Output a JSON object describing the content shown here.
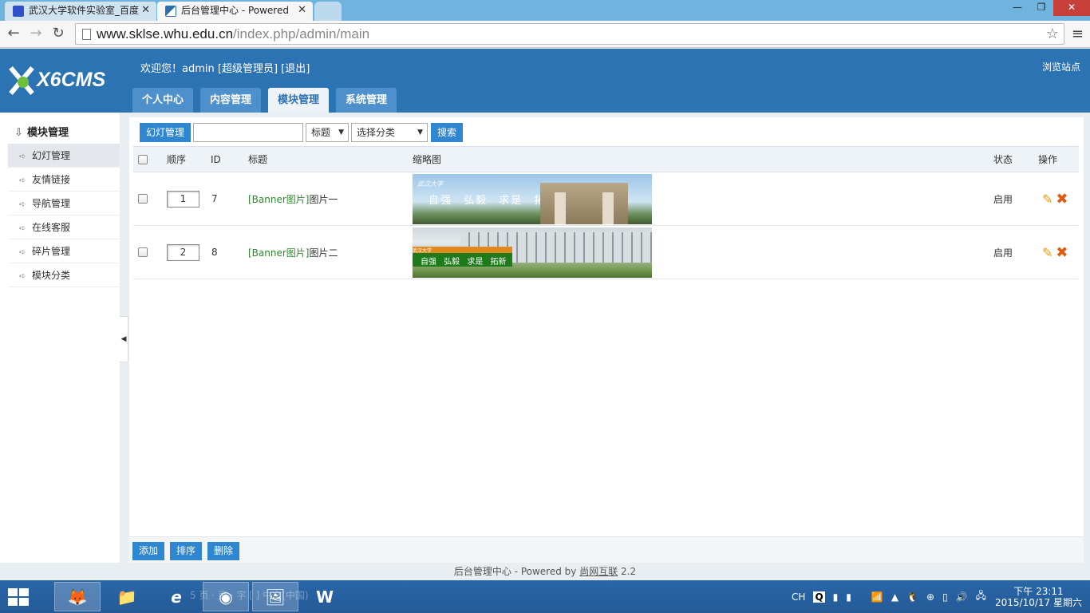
{
  "browser": {
    "tabs": [
      {
        "title": "武汉大学软件实验室_百度"
      },
      {
        "title": "后台管理中心 - Powered"
      }
    ],
    "url_host": "www.sklse.whu.edu.cn",
    "url_path": "/index.php/admin/main"
  },
  "header": {
    "logo_text": "X6CMS",
    "welcome_prefix": "欢迎您！admin",
    "role_link": "[超级管理员]",
    "logout_link": "[退出]",
    "browse_site": "浏览站点",
    "tabs": [
      {
        "label": "个人中心"
      },
      {
        "label": "内容管理"
      },
      {
        "label": "模块管理",
        "active": true
      },
      {
        "label": "系统管理"
      }
    ]
  },
  "sidebar": {
    "title": "模块管理",
    "items": [
      {
        "label": "幻灯管理",
        "active": true
      },
      {
        "label": "友情链接"
      },
      {
        "label": "导航管理"
      },
      {
        "label": "在线客服"
      },
      {
        "label": "碎片管理"
      },
      {
        "label": "模块分类"
      }
    ]
  },
  "filter": {
    "section_button": "幻灯管理",
    "search_value": "",
    "field_select": "标题",
    "category_select": "选择分类",
    "search_button": "搜索"
  },
  "table": {
    "headers": {
      "order": "顺序",
      "id": "ID",
      "title": "标题",
      "thumb": "缩略图",
      "status": "状态",
      "ops": "操作"
    },
    "rows": [
      {
        "order": "1",
        "id": "7",
        "category": "[Banner图片]",
        "title": "图片一",
        "status": "启用",
        "thumb_caption": "自强 弘毅 求是 拓新",
        "thumb_logo": "武汉大学"
      },
      {
        "order": "2",
        "id": "8",
        "category": "[Banner图片]",
        "title": "图片二",
        "status": "启用",
        "thumb_caption": "自强 弘毅 求是 拓新",
        "thumb_logo": "武汉大学"
      }
    ]
  },
  "bottom_actions": {
    "add": "添加",
    "sort": "排序",
    "delete": "删除"
  },
  "footer": {
    "prefix": "后台管理中心 - Powered by ",
    "brand": "尚网互联",
    "version": " 2.2"
  },
  "taskbar": {
    "ime": "CH",
    "ime_letter": "Q",
    "time": "下午 23:11",
    "date": "2015/10/17 星期六",
    "ghost_text": "5 页 · 页 · 字 [ ] 中文(中国)"
  },
  "colors": {
    "header_blue": "#2c73b4",
    "button_blue": "#2f86d1",
    "link_green": "#2a8a2a",
    "delete_orange": "#e05a10"
  }
}
